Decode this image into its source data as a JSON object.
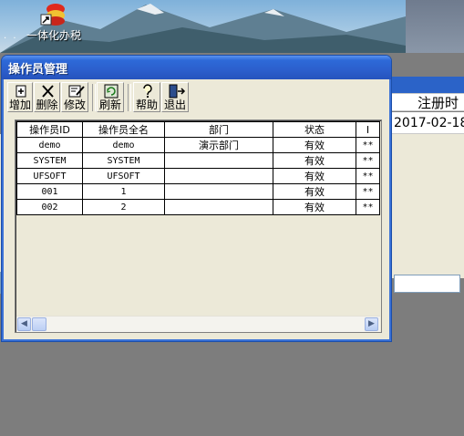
{
  "desktop": {
    "icon_label": "一体化办税",
    "dots": ". ."
  },
  "background_window": {
    "header_label": "注册时",
    "row_date": "2017-02-18"
  },
  "window": {
    "title": "操作员管理"
  },
  "toolbar": {
    "add_label": "增加",
    "delete_label": "删除",
    "edit_label": "修改",
    "refresh_label": "刷新",
    "help_label": "帮助",
    "exit_label": "退出"
  },
  "grid": {
    "columns": [
      "操作员ID",
      "操作员全名",
      "部门",
      "状态",
      "I"
    ],
    "rows": [
      [
        "demo",
        "demo",
        "演示部门",
        "有效",
        "**"
      ],
      [
        "SYSTEM",
        "SYSTEM",
        "",
        "有效",
        "**"
      ],
      [
        "UFSOFT",
        "UFSOFT",
        "",
        "有效",
        "**"
      ],
      [
        "001",
        "1",
        "",
        "有效",
        "**"
      ],
      [
        "002",
        "2",
        "",
        "有效",
        "**"
      ]
    ]
  },
  "scrollbar": {
    "left_arrow": "◀",
    "right_arrow": "▶"
  }
}
